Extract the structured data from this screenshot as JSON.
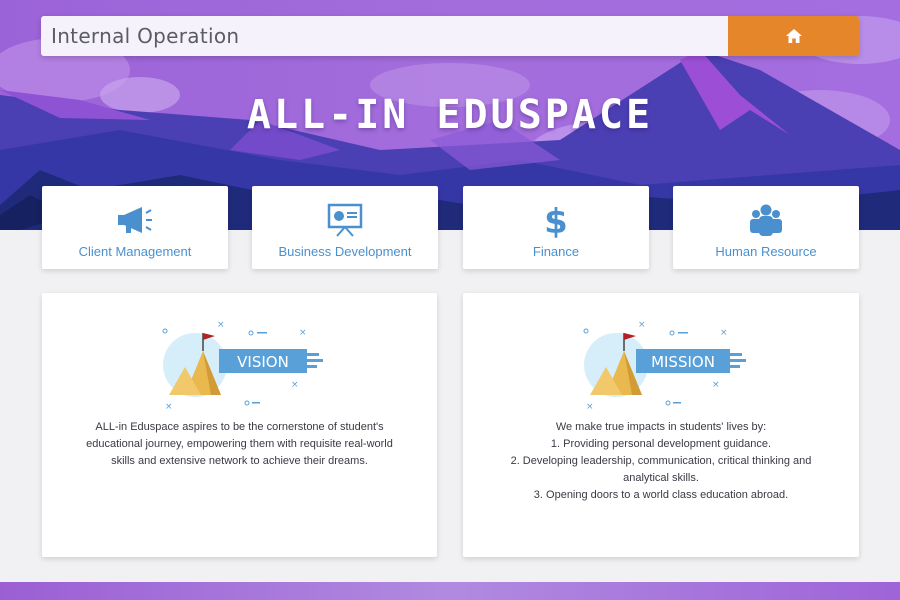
{
  "topbar": {
    "title": "Internal Operation",
    "home_icon": "home-icon"
  },
  "brand": {
    "title": "ALL-IN EDUSPACE"
  },
  "categories": [
    {
      "label": "Client Management",
      "icon": "megaphone-icon"
    },
    {
      "label": "Business Development",
      "icon": "presentation-board-icon"
    },
    {
      "label": "Finance",
      "icon": "dollar-icon"
    },
    {
      "label": "Human Resource",
      "icon": "people-icon"
    }
  ],
  "vision": {
    "banner": "VISION",
    "lines": [
      "ALL-in Eduspace aspires to be the cornerstone of student's",
      "educational journey, empowering them with requisite real-world",
      "skills and extensive network to achieve their dreams."
    ]
  },
  "mission": {
    "banner": "MISSION",
    "lines": [
      "We make true impacts in students' lives by:",
      "1. Providing personal development guidance.",
      "2. Developing leadership, communication, critical thinking and",
      "analytical skills.",
      "3. Opening doors to a world class education abroad."
    ]
  },
  "colors": {
    "accent_orange": "#e6862a",
    "label_blue": "#4a90cf",
    "hero_purple": "#9a5fd6",
    "mountain_blue": "#3d3fb5"
  }
}
